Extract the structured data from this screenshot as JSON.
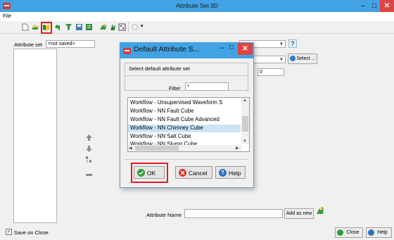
{
  "window": {
    "title": "Attribute Set 3D",
    "minimize_glyph": "–",
    "maximize_glyph": "□",
    "close_glyph": "✕"
  },
  "menu": {
    "file": "File"
  },
  "toolbar": {
    "icons": [
      "new-file-icon",
      "open-icon",
      "save-icon",
      "add-attribute-icon",
      "filter-icon",
      "save-db-icon",
      "report-icon",
      "attribute-tool-icon",
      "well-icon",
      "calculator-icon"
    ],
    "dropdown_glyph": "▾"
  },
  "attribute_set": {
    "label": "Attribute set",
    "value": "<not saved>"
  },
  "main": {
    "help_glyph": "?",
    "select_button": "Select ...",
    "value_0": "0",
    "attribute_name_label": "Attribute Name",
    "attribute_name_value": "",
    "add_as_new_button": "Add as new",
    "save_on_close_label": "Save on Close",
    "close_button": "Close",
    "help_button": "Help"
  },
  "dialog": {
    "title": "Default Attribute S...",
    "subtitle": "Select default attribute set",
    "filter_label": "Filter",
    "filter_value": "*",
    "items": [
      "Workflow - Unsupervised Waveform S",
      "Workflow - NN Fault Cube",
      "Workflow - NN Fault Cube Advanced",
      "Workflow - NN Chimney Cube",
      "Workflow - NN Salt Cube",
      "Workflow - NN Slump Cube"
    ],
    "selected_index": 3,
    "ok_button": "OK",
    "cancel_button": "Cancel",
    "help_button": "Help"
  },
  "colors": {
    "titlebar": "#41a2e4",
    "close": "#e04343",
    "highlight": "#e31b23",
    "selection": "#cde4f7"
  }
}
